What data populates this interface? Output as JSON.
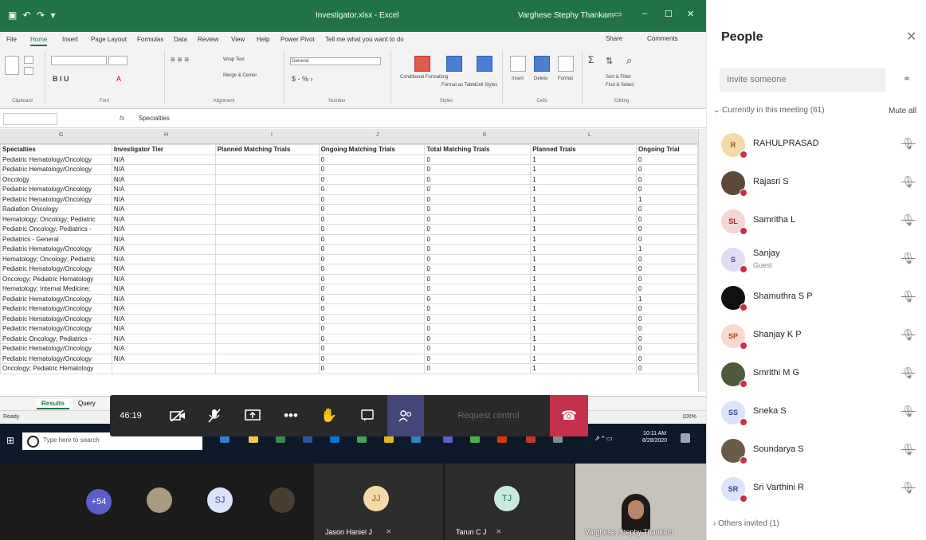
{
  "excel": {
    "title": "Investigator.xlsx - Excel",
    "user": "Varghese Stephy Thankam",
    "menu": [
      "File",
      "Home",
      "Insert",
      "Page Layout",
      "Formulas",
      "Data",
      "Review",
      "View",
      "Help",
      "Power Pivot",
      "Tell me what you want to do"
    ],
    "share": "Share",
    "comments": "Comments",
    "ribbon_groups": [
      "Clipboard",
      "Font",
      "Alignment",
      "Number",
      "Styles",
      "Cells",
      "Editing"
    ],
    "ribbon_labels": {
      "wrap_text": "Wrap Text",
      "merge": "Merge & Center",
      "number_format": "General",
      "conditional": "Conditional Formatting",
      "format_table": "Format as Table",
      "cell_styles": "Cell Styles",
      "insert": "Insert",
      "delete": "Delete",
      "format": "Format",
      "sort": "Sort & Filter",
      "find": "Find & Select"
    },
    "formula_value": "Specialties",
    "col_letters": [
      "G",
      "H",
      "I",
      "J",
      "K",
      "L"
    ],
    "headers": [
      "Specialties",
      "Investigator Tier",
      "Planned Matching Trials",
      "Ongoing Matching Trials",
      "Total Matching Trials",
      "Planned Trials",
      "Ongoing Trial"
    ],
    "rows": [
      [
        "Pediatric Hematology/Oncology",
        "N/A",
        "",
        "0",
        "0",
        "1",
        "0"
      ],
      [
        "Pediatric Hematology/Oncology",
        "N/A",
        "",
        "0",
        "0",
        "1",
        "0"
      ],
      [
        "Oncology",
        "N/A",
        "",
        "0",
        "0",
        "1",
        "0"
      ],
      [
        "Pediatric Hematology/Oncology",
        "N/A",
        "",
        "0",
        "0",
        "1",
        "0"
      ],
      [
        "Pediatric Hematology/Oncology",
        "N/A",
        "",
        "0",
        "0",
        "1",
        "1"
      ],
      [
        "Radiation Oncology",
        "N/A",
        "",
        "0",
        "0",
        "1",
        "0"
      ],
      [
        "Hematology; Oncology; Pediatric",
        "N/A",
        "",
        "0",
        "0",
        "1",
        "0"
      ],
      [
        "Pediatric Oncology; Pediatrics -",
        "N/A",
        "",
        "0",
        "0",
        "1",
        "0"
      ],
      [
        "Pediatrics - General",
        "N/A",
        "",
        "0",
        "0",
        "1",
        "0"
      ],
      [
        "Pediatric Hematology/Oncology",
        "N/A",
        "",
        "0",
        "0",
        "1",
        "1"
      ],
      [
        "Hematology; Oncology; Pediatric",
        "N/A",
        "",
        "0",
        "0",
        "1",
        "0"
      ],
      [
        "Pediatric Hematology/Oncology",
        "N/A",
        "",
        "0",
        "0",
        "1",
        "0"
      ],
      [
        "Oncology; Pediatric Hematology",
        "N/A",
        "",
        "0",
        "0",
        "1",
        "0"
      ],
      [
        "Hematology; Internal Medicine;",
        "N/A",
        "",
        "0",
        "0",
        "1",
        "0"
      ],
      [
        "Pediatric Hematology/Oncology",
        "N/A",
        "",
        "0",
        "0",
        "1",
        "1"
      ],
      [
        "Pediatric Hematology/Oncology",
        "N/A",
        "",
        "0",
        "0",
        "1",
        "0"
      ],
      [
        "Pediatric Hematology/Oncology",
        "N/A",
        "",
        "0",
        "0",
        "1",
        "0"
      ],
      [
        "Pediatric Hematology/Oncology",
        "N/A",
        "",
        "0",
        "0",
        "1",
        "0"
      ],
      [
        "Pediatric Oncology; Pediatrics -",
        "N/A",
        "",
        "0",
        "0",
        "1",
        "0"
      ],
      [
        "Pediatric Hematology/Oncology",
        "N/A",
        "",
        "0",
        "0",
        "1",
        "0"
      ],
      [
        "Pediatric Hematology/Oncology",
        "N/A",
        "",
        "0",
        "0",
        "1",
        "0"
      ],
      [
        "Oncology; Pediatric Hematology",
        "",
        "",
        "0",
        "0",
        "1",
        "0"
      ]
    ],
    "sheet_tabs": [
      "Results",
      "Query"
    ],
    "status_left": "Ready",
    "zoom": "100%",
    "taskbar_search": "Type here to search",
    "clock_time": "10:11 AM",
    "clock_date": "8/28/2020"
  },
  "call": {
    "timer": "46:19",
    "request_control": "Request control"
  },
  "strip": {
    "overflow_count": "+54",
    "sj": "SJ",
    "jj": "JJ",
    "jj_name": "Jason Haniel J",
    "tj": "TJ",
    "tj_name": "Tarun C J",
    "video_name": "Varghese, Stephy Thankam"
  },
  "people": {
    "title": "People",
    "invite_placeholder": "Invite someone",
    "section": "Currently in this meeting (61)",
    "mute_all": "Mute all",
    "list": [
      {
        "initials": "R",
        "name": "RAHULPRASAD",
        "sub": "",
        "bg": "#f6d9a9",
        "fg": "#8a5a14",
        "photo": false
      },
      {
        "initials": "",
        "name": "Rajasri S",
        "sub": "",
        "bg": "#5b4a3a",
        "fg": "#fff",
        "photo": true
      },
      {
        "initials": "SL",
        "name": "Samritha L",
        "sub": "",
        "bg": "#f7d4d6",
        "fg": "#a4262c",
        "photo": false
      },
      {
        "initials": "S",
        "name": "Sanjay",
        "sub": "Guest",
        "bg": "#e1dcf3",
        "fg": "#4f3ea3",
        "photo": false
      },
      {
        "initials": "",
        "name": "Shamuthra S P",
        "sub": "",
        "bg": "#111",
        "fg": "#fff",
        "photo": true
      },
      {
        "initials": "SP",
        "name": "Shanjay K P",
        "sub": "",
        "bg": "#fbd8ce",
        "fg": "#b13e16",
        "photo": false
      },
      {
        "initials": "",
        "name": "Smrithi M G",
        "sub": "",
        "bg": "#4e5b3a",
        "fg": "#fff",
        "photo": true
      },
      {
        "initials": "SS",
        "name": "Sneka S",
        "sub": "",
        "bg": "#dbe3fa",
        "fg": "#34448e",
        "photo": false
      },
      {
        "initials": "",
        "name": "Soundarya S",
        "sub": "",
        "bg": "#6a5a48",
        "fg": "#fff",
        "photo": true
      },
      {
        "initials": "SR",
        "name": "Sri Varthini R",
        "sub": "",
        "bg": "#dbe3fa",
        "fg": "#34448e",
        "photo": false
      }
    ],
    "others": "Others invited (1)"
  },
  "colors": {
    "excel_green": "#217346",
    "hangup": "#c4314b",
    "teams_purple": "#464775"
  }
}
